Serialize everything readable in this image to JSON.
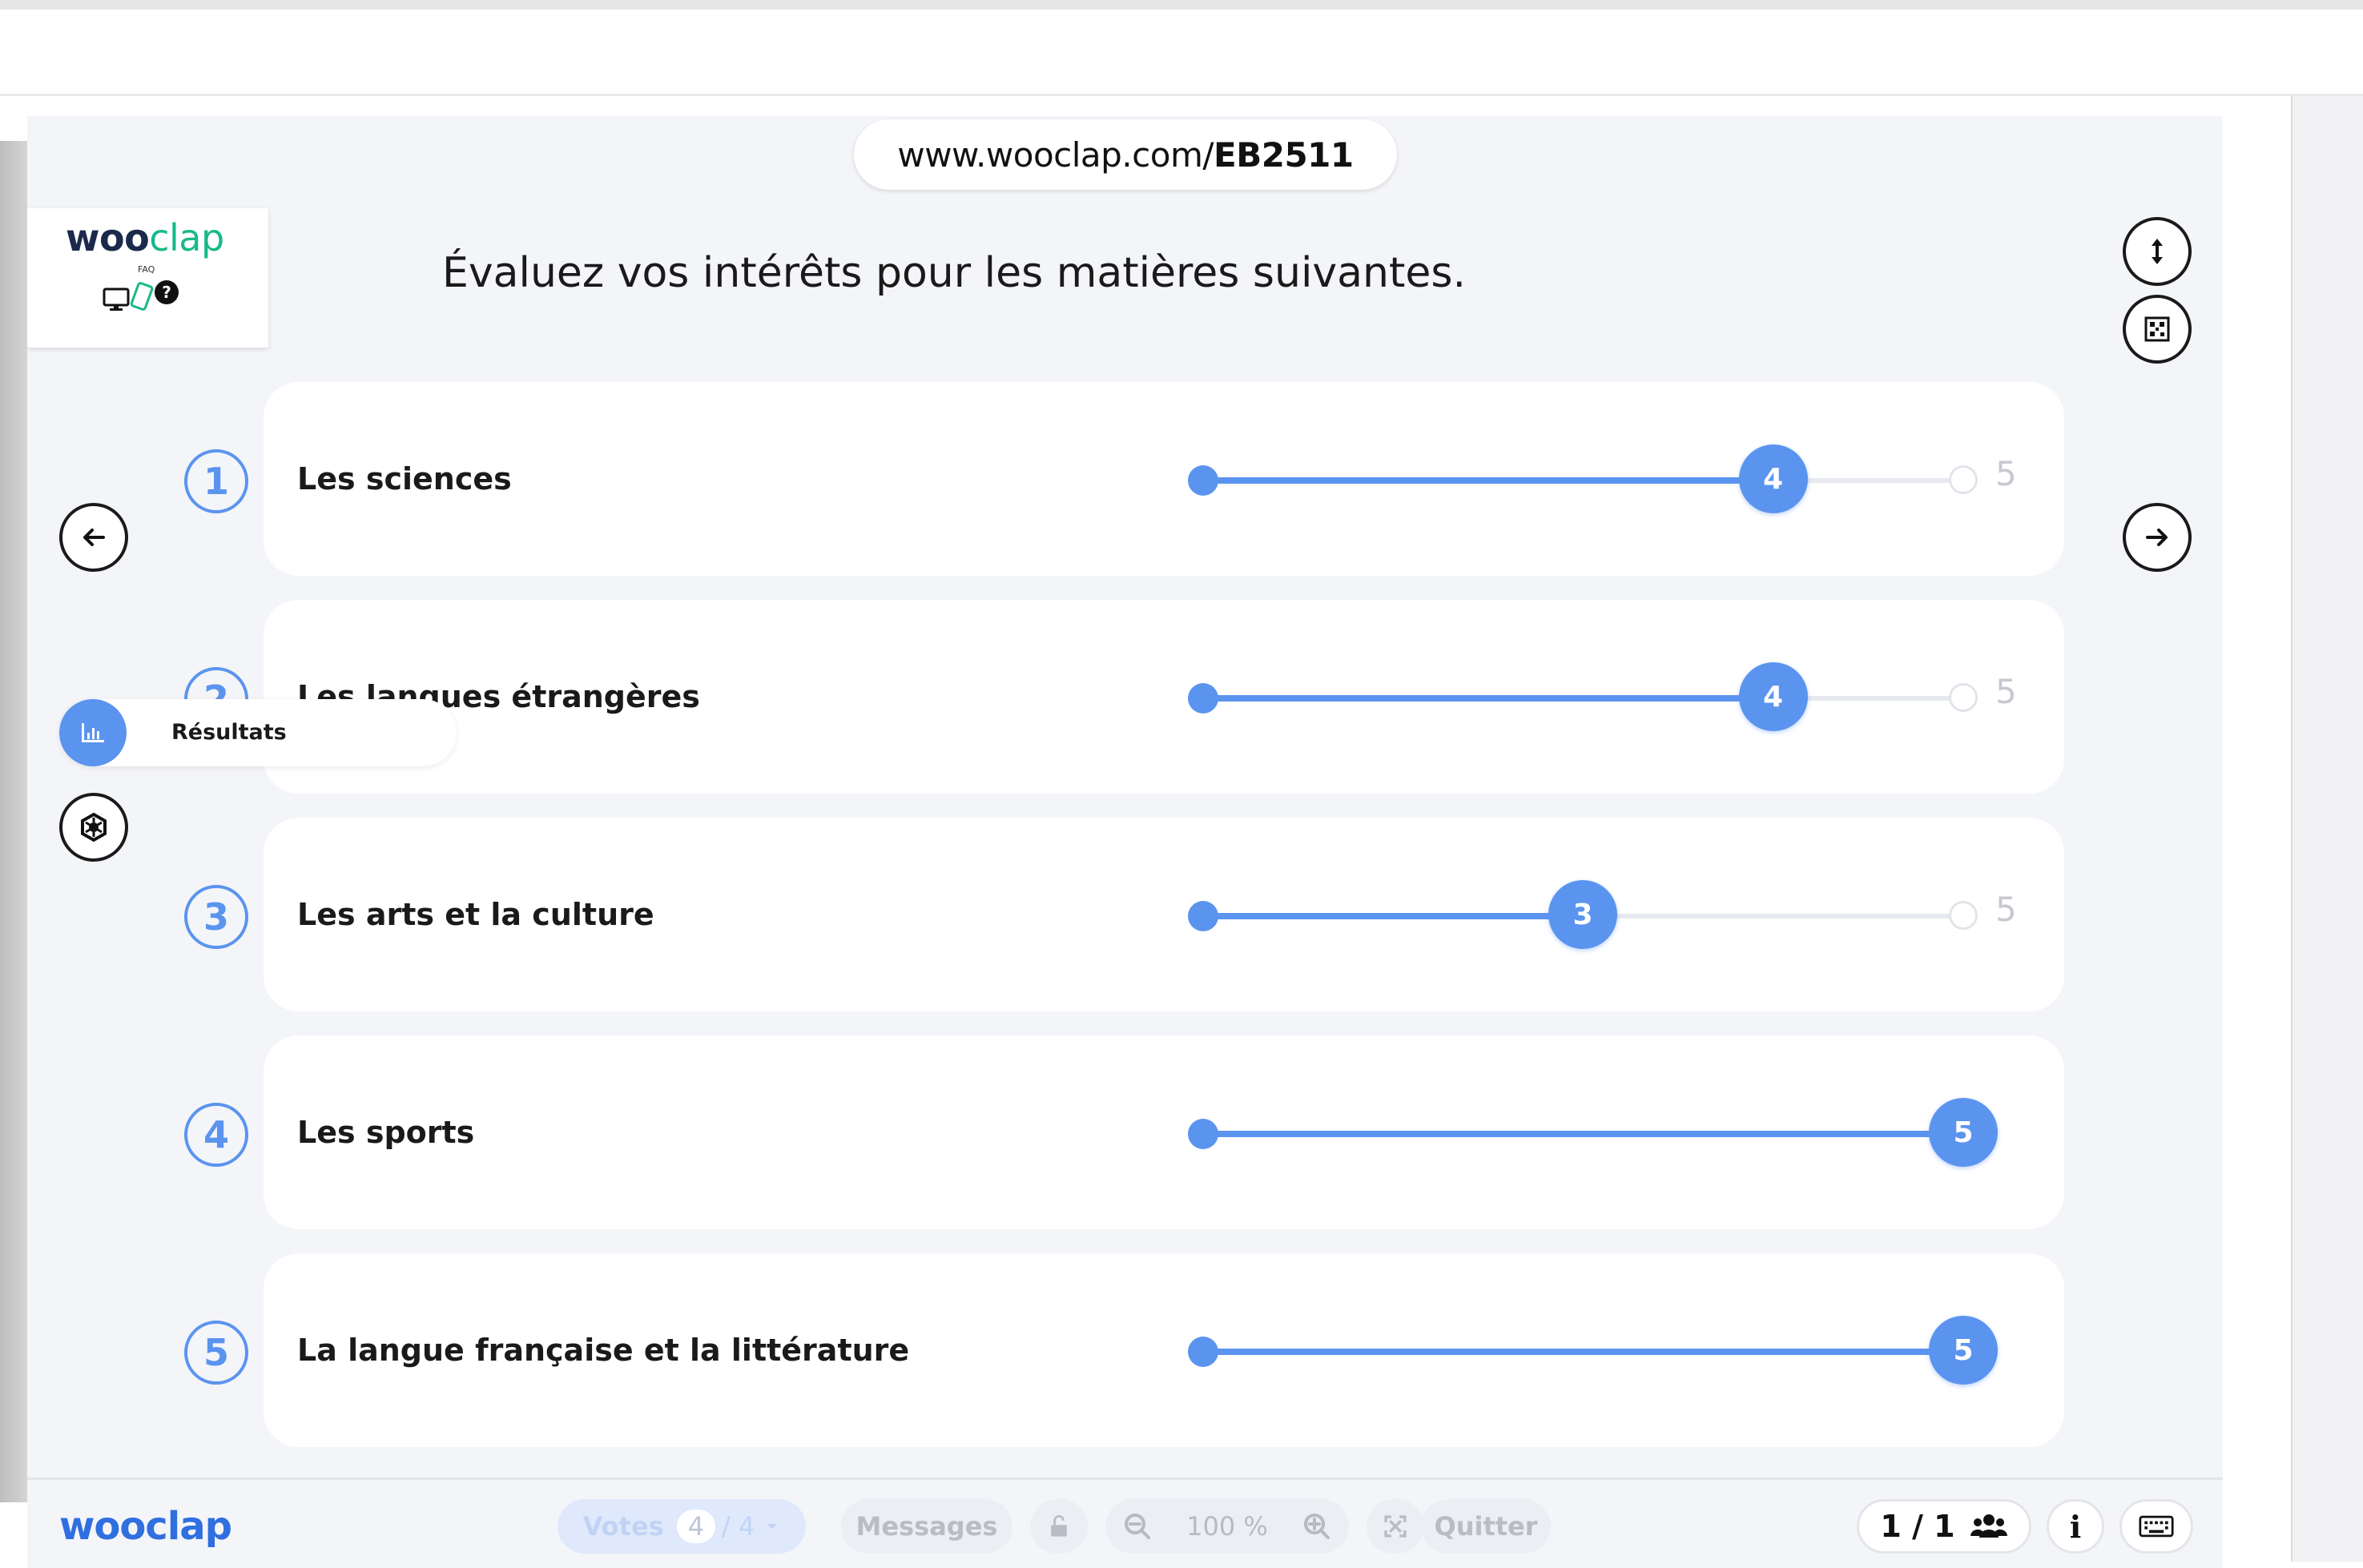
{
  "session": {
    "url_prefix": "www.wooclap.com/",
    "event_code": "EB2511"
  },
  "logo_card": {
    "brand_left": "woo",
    "brand_right": "clap",
    "faq": "FAQ"
  },
  "question": {
    "title": "Évaluez vos intérêts pour les matières suivantes."
  },
  "scale": {
    "max": 5
  },
  "rows": [
    {
      "number": "1",
      "label": "Les sciences",
      "value": 4,
      "max_label": "5"
    },
    {
      "number": "2",
      "label": "Les langues étrangères",
      "value": 4,
      "max_label": "5"
    },
    {
      "number": "3",
      "label": "Les arts et la culture",
      "value": 3,
      "max_label": "5"
    },
    {
      "number": "4",
      "label": "Les sports",
      "value": 5,
      "max_label": "5"
    },
    {
      "number": "5",
      "label": "La langue française et la littérature",
      "value": 5,
      "max_label": "5"
    }
  ],
  "results_button": {
    "label": "Résultats"
  },
  "bottom_bar": {
    "logo": "wooclap",
    "votes_label": "Votes",
    "votes_count": "4",
    "votes_total": "/ 4",
    "messages_label": "Messages",
    "zoom_value": "100 %",
    "quit_label": "Quitter",
    "participants": "1 / 1",
    "info_label": "i"
  },
  "colors": {
    "accent": "#5b94ef",
    "brand_blue": "#2f6fe0",
    "brand_green": "#18b98a",
    "stage_bg": "#f4f5f9"
  },
  "icons": [
    "arrow-left-icon",
    "arrow-right-icon",
    "vertical-resize-icon",
    "qr-code-icon",
    "bar-chart-icon",
    "settings-hex-icon",
    "monitor-icon",
    "phone-icon",
    "question-bubble-icon",
    "dropdown-caret-icon",
    "unlock-icon",
    "zoom-out-icon",
    "zoom-in-icon",
    "fullscreen-icon",
    "users-icon",
    "keyboard-icon"
  ]
}
